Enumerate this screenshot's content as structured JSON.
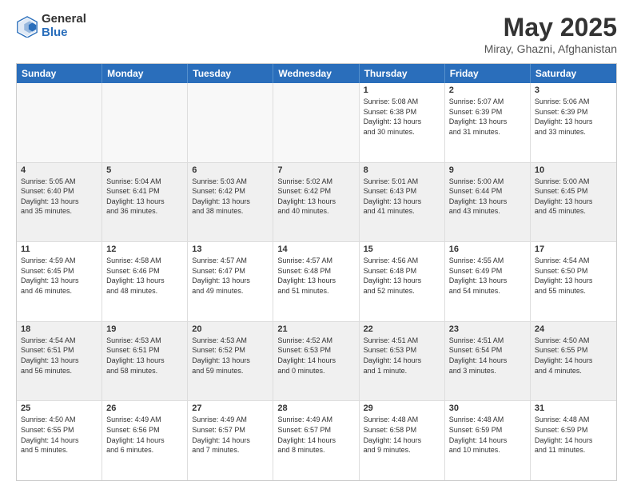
{
  "header": {
    "logo_general": "General",
    "logo_blue": "Blue",
    "month": "May 2025",
    "location": "Miray, Ghazni, Afghanistan"
  },
  "calendar": {
    "days": [
      "Sunday",
      "Monday",
      "Tuesday",
      "Wednesday",
      "Thursday",
      "Friday",
      "Saturday"
    ],
    "rows": [
      [
        {
          "day": "",
          "text": ""
        },
        {
          "day": "",
          "text": ""
        },
        {
          "day": "",
          "text": ""
        },
        {
          "day": "",
          "text": ""
        },
        {
          "day": "1",
          "text": "Sunrise: 5:08 AM\nSunset: 6:38 PM\nDaylight: 13 hours\nand 30 minutes."
        },
        {
          "day": "2",
          "text": "Sunrise: 5:07 AM\nSunset: 6:39 PM\nDaylight: 13 hours\nand 31 minutes."
        },
        {
          "day": "3",
          "text": "Sunrise: 5:06 AM\nSunset: 6:39 PM\nDaylight: 13 hours\nand 33 minutes."
        }
      ],
      [
        {
          "day": "4",
          "text": "Sunrise: 5:05 AM\nSunset: 6:40 PM\nDaylight: 13 hours\nand 35 minutes."
        },
        {
          "day": "5",
          "text": "Sunrise: 5:04 AM\nSunset: 6:41 PM\nDaylight: 13 hours\nand 36 minutes."
        },
        {
          "day": "6",
          "text": "Sunrise: 5:03 AM\nSunset: 6:42 PM\nDaylight: 13 hours\nand 38 minutes."
        },
        {
          "day": "7",
          "text": "Sunrise: 5:02 AM\nSunset: 6:42 PM\nDaylight: 13 hours\nand 40 minutes."
        },
        {
          "day": "8",
          "text": "Sunrise: 5:01 AM\nSunset: 6:43 PM\nDaylight: 13 hours\nand 41 minutes."
        },
        {
          "day": "9",
          "text": "Sunrise: 5:00 AM\nSunset: 6:44 PM\nDaylight: 13 hours\nand 43 minutes."
        },
        {
          "day": "10",
          "text": "Sunrise: 5:00 AM\nSunset: 6:45 PM\nDaylight: 13 hours\nand 45 minutes."
        }
      ],
      [
        {
          "day": "11",
          "text": "Sunrise: 4:59 AM\nSunset: 6:45 PM\nDaylight: 13 hours\nand 46 minutes."
        },
        {
          "day": "12",
          "text": "Sunrise: 4:58 AM\nSunset: 6:46 PM\nDaylight: 13 hours\nand 48 minutes."
        },
        {
          "day": "13",
          "text": "Sunrise: 4:57 AM\nSunset: 6:47 PM\nDaylight: 13 hours\nand 49 minutes."
        },
        {
          "day": "14",
          "text": "Sunrise: 4:57 AM\nSunset: 6:48 PM\nDaylight: 13 hours\nand 51 minutes."
        },
        {
          "day": "15",
          "text": "Sunrise: 4:56 AM\nSunset: 6:48 PM\nDaylight: 13 hours\nand 52 minutes."
        },
        {
          "day": "16",
          "text": "Sunrise: 4:55 AM\nSunset: 6:49 PM\nDaylight: 13 hours\nand 54 minutes."
        },
        {
          "day": "17",
          "text": "Sunrise: 4:54 AM\nSunset: 6:50 PM\nDaylight: 13 hours\nand 55 minutes."
        }
      ],
      [
        {
          "day": "18",
          "text": "Sunrise: 4:54 AM\nSunset: 6:51 PM\nDaylight: 13 hours\nand 56 minutes."
        },
        {
          "day": "19",
          "text": "Sunrise: 4:53 AM\nSunset: 6:51 PM\nDaylight: 13 hours\nand 58 minutes."
        },
        {
          "day": "20",
          "text": "Sunrise: 4:53 AM\nSunset: 6:52 PM\nDaylight: 13 hours\nand 59 minutes."
        },
        {
          "day": "21",
          "text": "Sunrise: 4:52 AM\nSunset: 6:53 PM\nDaylight: 14 hours\nand 0 minutes."
        },
        {
          "day": "22",
          "text": "Sunrise: 4:51 AM\nSunset: 6:53 PM\nDaylight: 14 hours\nand 1 minute."
        },
        {
          "day": "23",
          "text": "Sunrise: 4:51 AM\nSunset: 6:54 PM\nDaylight: 14 hours\nand 3 minutes."
        },
        {
          "day": "24",
          "text": "Sunrise: 4:50 AM\nSunset: 6:55 PM\nDaylight: 14 hours\nand 4 minutes."
        }
      ],
      [
        {
          "day": "25",
          "text": "Sunrise: 4:50 AM\nSunset: 6:55 PM\nDaylight: 14 hours\nand 5 minutes."
        },
        {
          "day": "26",
          "text": "Sunrise: 4:49 AM\nSunset: 6:56 PM\nDaylight: 14 hours\nand 6 minutes."
        },
        {
          "day": "27",
          "text": "Sunrise: 4:49 AM\nSunset: 6:57 PM\nDaylight: 14 hours\nand 7 minutes."
        },
        {
          "day": "28",
          "text": "Sunrise: 4:49 AM\nSunset: 6:57 PM\nDaylight: 14 hours\nand 8 minutes."
        },
        {
          "day": "29",
          "text": "Sunrise: 4:48 AM\nSunset: 6:58 PM\nDaylight: 14 hours\nand 9 minutes."
        },
        {
          "day": "30",
          "text": "Sunrise: 4:48 AM\nSunset: 6:59 PM\nDaylight: 14 hours\nand 10 minutes."
        },
        {
          "day": "31",
          "text": "Sunrise: 4:48 AM\nSunset: 6:59 PM\nDaylight: 14 hours\nand 11 minutes."
        }
      ]
    ]
  }
}
